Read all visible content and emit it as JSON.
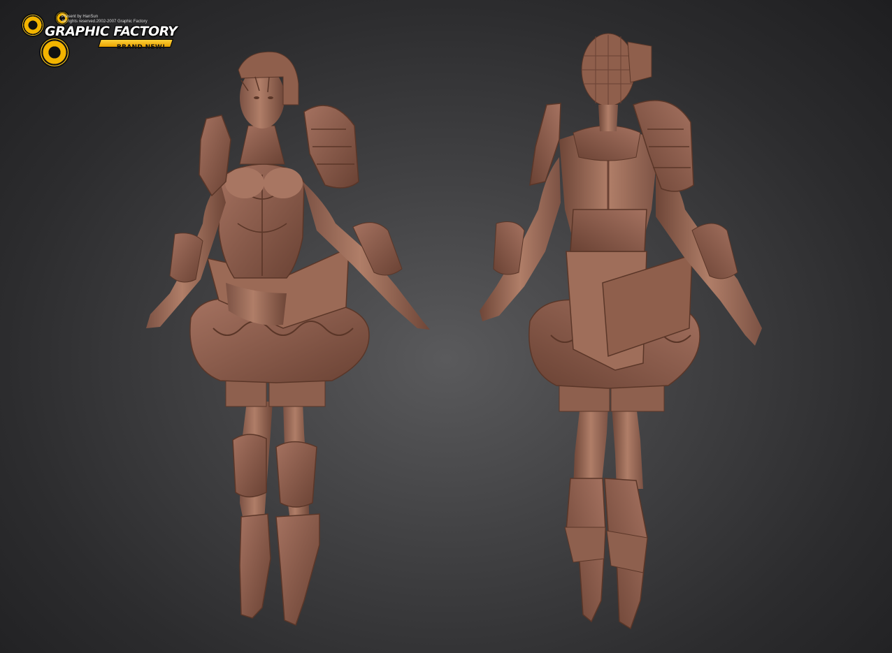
{
  "logo": {
    "brand": "GRAPHIC FACTORY",
    "badge": "BRAND NEW!",
    "credit_line": "Present by HanSun",
    "rights_line": "All rights reserved.2002-2007 Graphic Factory"
  },
  "colors": {
    "sculpt_base": "#9a6a58",
    "sculpt_shadow": "#5e3a2e",
    "sculpt_highlight": "#c08a74",
    "logo_accent": "#f2b400",
    "background_center": "#5a5a5c",
    "background_edge": "#1e1e20"
  },
  "views": [
    {
      "name": "front"
    },
    {
      "name": "back"
    }
  ]
}
